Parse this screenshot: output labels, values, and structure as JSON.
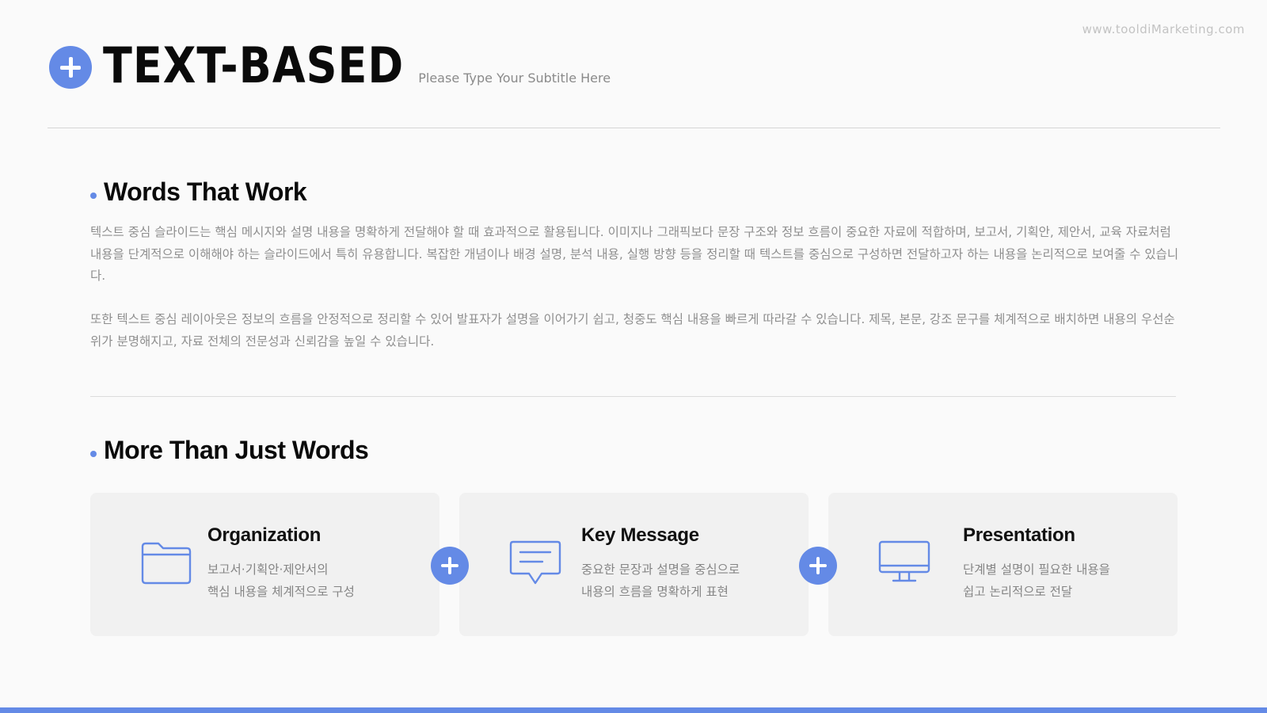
{
  "site_url": "www.tooldiMarketing.com",
  "header": {
    "title": "TEXT-BASED",
    "subtitle": "Please Type Your Subtitle Here"
  },
  "section1": {
    "heading": "Words That Work",
    "paragraph1": "텍스트 중심 슬라이드는 핵심 메시지와 설명 내용을 명확하게 전달해야 할 때 효과적으로 활용됩니다. 이미지나 그래픽보다 문장 구조와 정보 흐름이 중요한 자료에 적합하며, 보고서, 기획안, 제안서, 교육 자료처럼 내용을 단계적으로 이해해야 하는 슬라이드에서 특히 유용합니다. 복잡한 개념이나 배경 설명, 분석 내용, 실행 방향 등을 정리할 때 텍스트를 중심으로 구성하면 전달하고자 하는 내용을 논리적으로 보여줄 수 있습니다.",
    "paragraph2": "또한 텍스트 중심 레이아웃은 정보의 흐름을 안정적으로 정리할 수 있어 발표자가 설명을 이어가기 쉽고, 청중도 핵심 내용을 빠르게 따라갈 수 있습니다. 제목, 본문, 강조 문구를 체계적으로 배치하면 내용의 우선순위가 분명해지고, 자료 전체의 전문성과 신뢰감을 높일 수 있습니다."
  },
  "section2": {
    "heading": "More Than Just Words",
    "cards": [
      {
        "title": "Organization",
        "desc_line1": "보고서·기획안·제안서의",
        "desc_line2": "핵심 내용을 체계적으로 구성",
        "icon": "folder-icon"
      },
      {
        "title": "Key Message",
        "desc_line1": "중요한 문장과 설명을 중심으로",
        "desc_line2": "내용의 흐름을 명확하게 표현",
        "icon": "chat-bubble-icon"
      },
      {
        "title": "Presentation",
        "desc_line1": "단계별 설명이 필요한 내용을",
        "desc_line2": "쉽고 논리적으로 전달",
        "icon": "monitor-icon"
      }
    ]
  },
  "colors": {
    "accent": "#648ae6",
    "background": "#fafafa",
    "card_background": "#f1f1f1",
    "body_text": "#8e8e8e"
  }
}
